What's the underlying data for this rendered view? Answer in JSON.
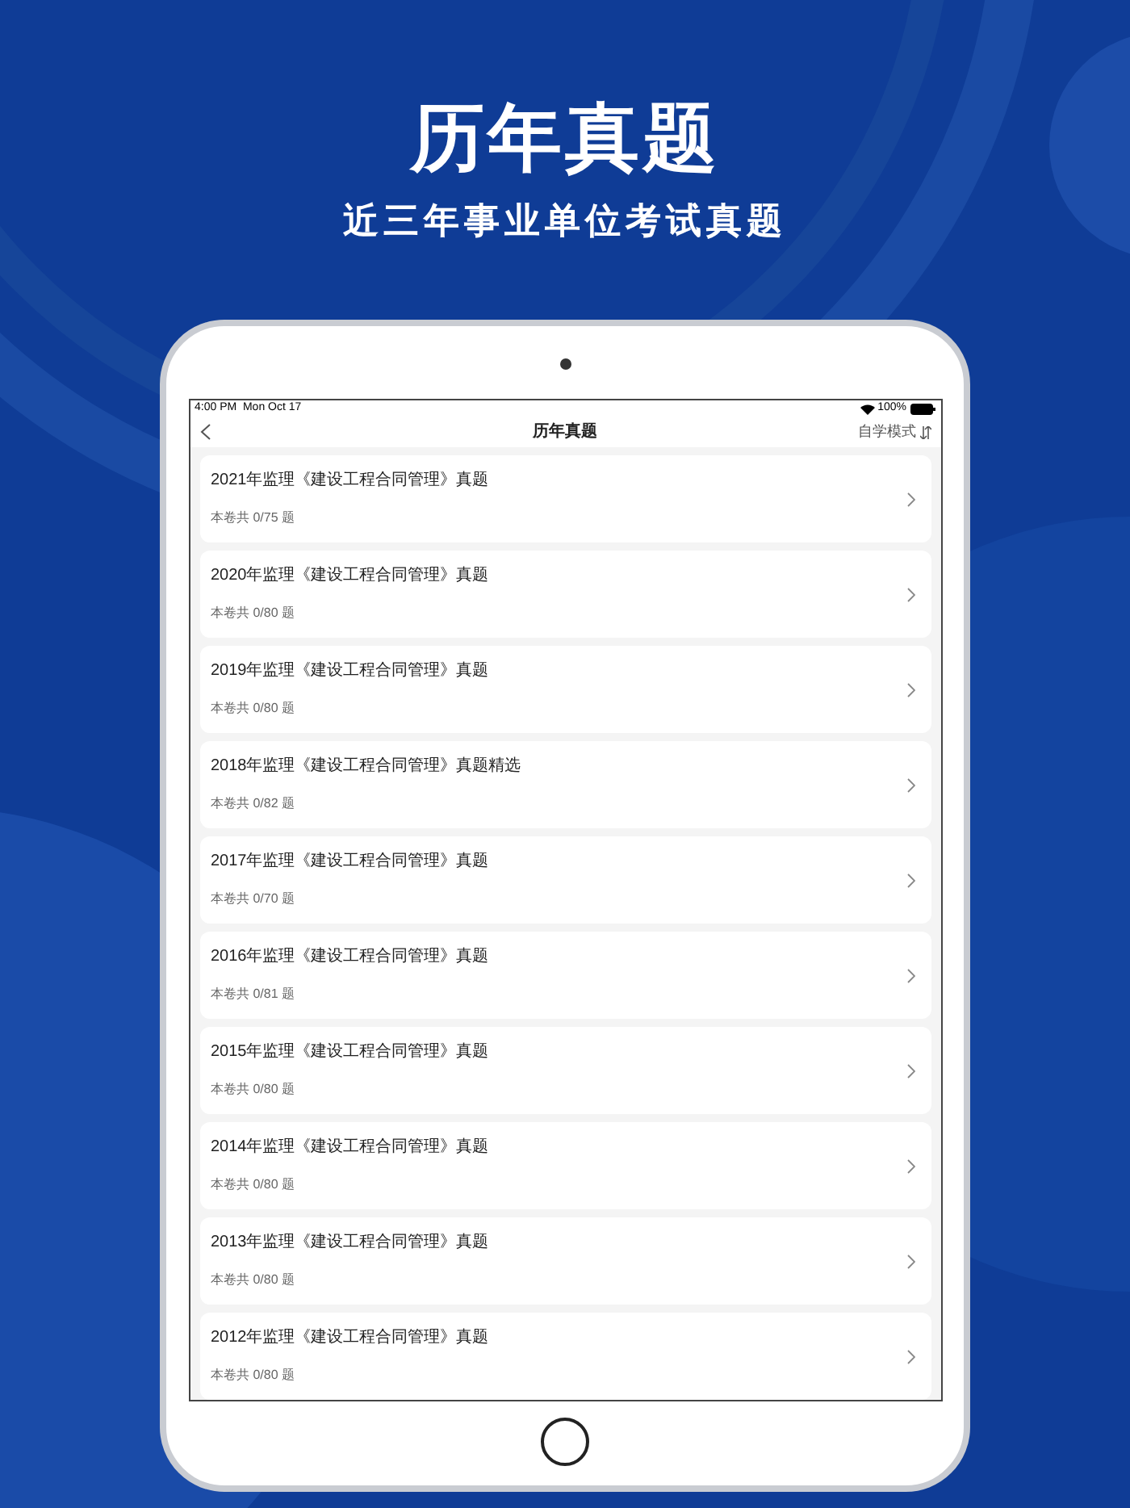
{
  "headline": "历年真题",
  "subheadline": "近三年事业单位考试真题",
  "status_bar": {
    "time": "4:00 PM",
    "date": "Mon Oct 17",
    "battery": "100%"
  },
  "nav": {
    "title": "历年真题",
    "mode_button": "自学模式"
  },
  "papers": [
    {
      "title": "2021年监理《建设工程合同管理》真题",
      "progress": "本卷共 0/75 题"
    },
    {
      "title": "2020年监理《建设工程合同管理》真题",
      "progress": "本卷共 0/80 题"
    },
    {
      "title": "2019年监理《建设工程合同管理》真题",
      "progress": "本卷共 0/80 题"
    },
    {
      "title": "2018年监理《建设工程合同管理》真题精选",
      "progress": "本卷共 0/82 题"
    },
    {
      "title": "2017年监理《建设工程合同管理》真题",
      "progress": "本卷共 0/70 题"
    },
    {
      "title": "2016年监理《建设工程合同管理》真题",
      "progress": "本卷共 0/81 题"
    },
    {
      "title": "2015年监理《建设工程合同管理》真题",
      "progress": "本卷共 0/80 题"
    },
    {
      "title": "2014年监理《建设工程合同管理》真题",
      "progress": "本卷共 0/80 题"
    },
    {
      "title": "2013年监理《建设工程合同管理》真题",
      "progress": "本卷共 0/80 题"
    },
    {
      "title": "2012年监理《建设工程合同管理》真题",
      "progress": "本卷共 0/80 题"
    }
  ]
}
